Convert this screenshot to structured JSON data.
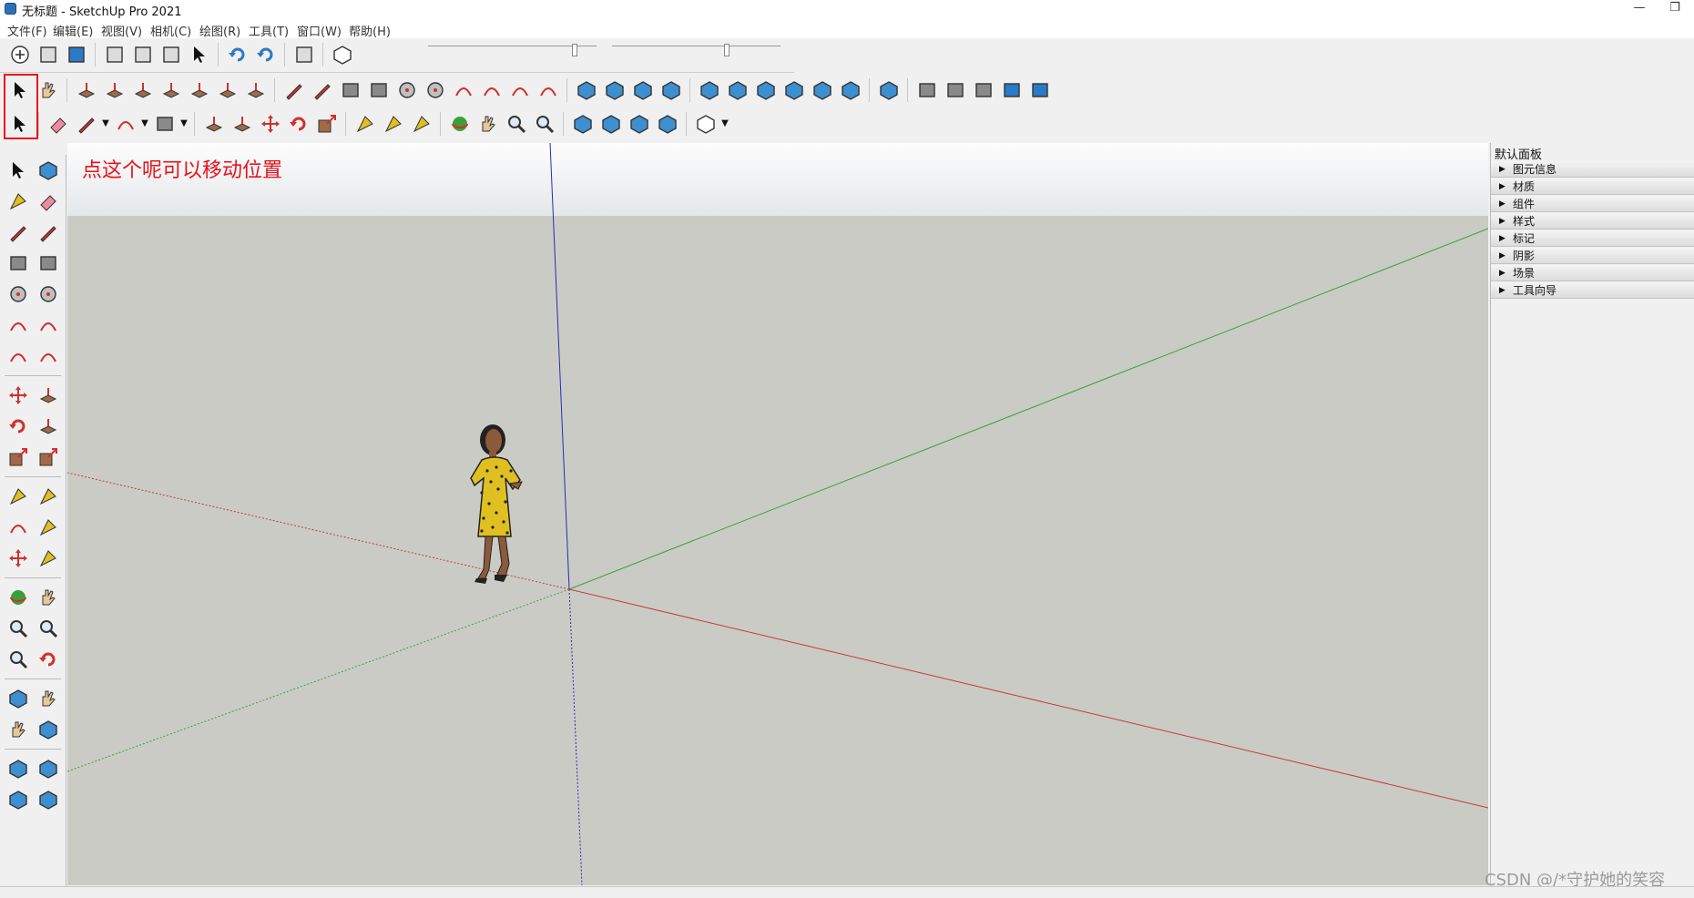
{
  "window": {
    "title": "无标题 - SketchUp Pro 2021",
    "minimize_glyph": "—",
    "restore_glyph": "❐"
  },
  "menu": [
    {
      "label": "文件(F)"
    },
    {
      "label": "编辑(E)"
    },
    {
      "label": "视图(V)"
    },
    {
      "label": "相机(C)"
    },
    {
      "label": "绘图(R)"
    },
    {
      "label": "工具(T)"
    },
    {
      "label": "窗口(W)"
    },
    {
      "label": "帮助(H)"
    }
  ],
  "toolbar_row1": [
    "new-icon",
    "open-icon",
    "save-icon",
    "sep",
    "cut-icon",
    "copy-icon",
    "paste-icon",
    "erase-selection-icon",
    "sep",
    "undo-icon",
    "redo-icon",
    "sep",
    "print-icon",
    "sep",
    "model-info-icon"
  ],
  "toolbar_row2": [
    "select-icon",
    "walkthrough-icon",
    "sep",
    "sandbox-from-contours-icon",
    "sandbox-from-scratch-icon",
    "smoove-icon",
    "stamp-icon",
    "drape-icon",
    "add-detail-icon",
    "flip-edge-icon",
    "sep",
    "pencil-line-icon",
    "freehand-icon",
    "rectangle-icon",
    "rotated-rectangle-icon",
    "circle-icon",
    "polygon-icon",
    "arc-icon",
    "two-point-arc-icon",
    "three-point-arc-icon",
    "pie-icon",
    "sep",
    "position-camera-icon",
    "section-plane-icon",
    "display-section-planes-icon",
    "display-section-cuts-icon",
    "sep",
    "iso-view-icon",
    "top-view-icon",
    "front-view-icon",
    "right-view-icon",
    "back-view-icon",
    "left-view-icon",
    "sep",
    "xray-icon",
    "sep",
    "back-edges-icon",
    "wireframe-icon",
    "hidden-line-icon",
    "shaded-icon",
    "shaded-textures-icon"
  ],
  "toolbar_row3": [
    "select-arrow-icon",
    "sep",
    "eraser-icon",
    "pencil-icon",
    "dropdown",
    "arc-tool-icon",
    "dropdown",
    "shape-icon",
    "dropdown",
    "sep",
    "push-pull-icon",
    "follow-me-icon",
    "move-icon",
    "rotate-icon",
    "scale-icon",
    "sep",
    "tape-measure-icon",
    "text-icon",
    "paint-bucket-icon",
    "sep",
    "orbit-icon",
    "pan-icon",
    "zoom-icon",
    "zoom-extents-icon",
    "sep",
    "warehouse-icon",
    "extension-warehouse-icon",
    "layout-icon",
    "extension-manager-icon",
    "sep",
    "account-icon",
    "dropdown"
  ],
  "left_toolbar": [
    [
      "select-icon",
      "component-icon"
    ],
    [
      "paint-bucket-icon",
      "eraser-icon"
    ],
    [
      "pencil-line-icon",
      "freehand-icon"
    ],
    [
      "rectangle-icon",
      "rotated-rectangle-icon"
    ],
    [
      "circle-icon",
      "polygon-icon"
    ],
    [
      "arc-icon",
      "two-point-arc-icon"
    ],
    [
      "three-point-arc-icon",
      "pie-icon"
    ],
    [
      "sep"
    ],
    [
      "move-icon",
      "push-pull-icon"
    ],
    [
      "rotate-icon",
      "follow-me-icon"
    ],
    [
      "scale-icon",
      "offset-icon"
    ],
    [
      "sep"
    ],
    [
      "tape-measure-icon",
      "dimension-icon"
    ],
    [
      "protractor-icon",
      "text-icon"
    ],
    [
      "axes-icon",
      "3d-text-icon"
    ],
    [
      "sep"
    ],
    [
      "orbit-icon",
      "pan-icon"
    ],
    [
      "zoom-icon",
      "zoom-window-icon"
    ],
    [
      "zoom-extents-icon",
      "previous-view-icon"
    ],
    [
      "sep"
    ],
    [
      "position-camera-icon",
      "look-around-icon"
    ],
    [
      "walk-icon",
      "section-plane-icon"
    ],
    [
      "sep"
    ],
    [
      "warehouse-icon",
      "extension-warehouse-icon"
    ],
    [
      "layout-icon",
      "extension-manager-icon"
    ]
  ],
  "annotation": "点这个呢可以移动位置",
  "tray": {
    "title": "默认面板",
    "items": [
      "图元信息",
      "材质",
      "组件",
      "样式",
      "标记",
      "阴影",
      "场景",
      "工具向导"
    ]
  },
  "watermark": "CSDN @/*守护她的笑容",
  "colors": {
    "annotation": "#e8131b",
    "axis_red": "#c23a3a",
    "axis_green": "#3aa03a",
    "axis_blue": "#2b2bb8",
    "viewport_ground": "#cbcbc6"
  }
}
